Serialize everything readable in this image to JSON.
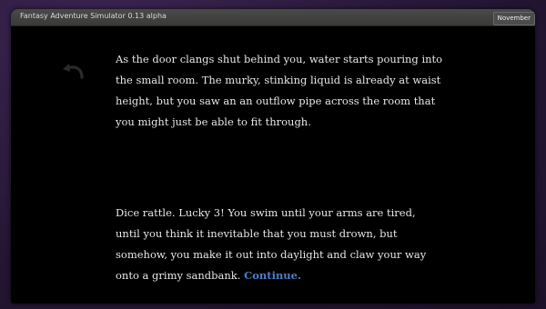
{
  "window": {
    "title": "Fantasy Adventure Simulator 0.13 alpha",
    "date_badge": "November"
  },
  "icons": {
    "undo": "undo-arrow-icon"
  },
  "story": {
    "paragraph_1": "As the door clangs shut behind you, water starts pouring into the small room. The murky, stinking liquid is already at waist height, but you saw an an outflow pipe across the room that you might just be able to fit through.",
    "paragraph_2": "Dice rattle. Lucky 3! You swim until your arms are tired, until you think it inevitable that you must drown, but somehow, you make it out into daylight and claw your way onto a grimy sandbank.",
    "continue_label": "Continue."
  },
  "colors": {
    "background": "#000000",
    "text": "#e6e6e6",
    "link": "#4a7fc9"
  }
}
